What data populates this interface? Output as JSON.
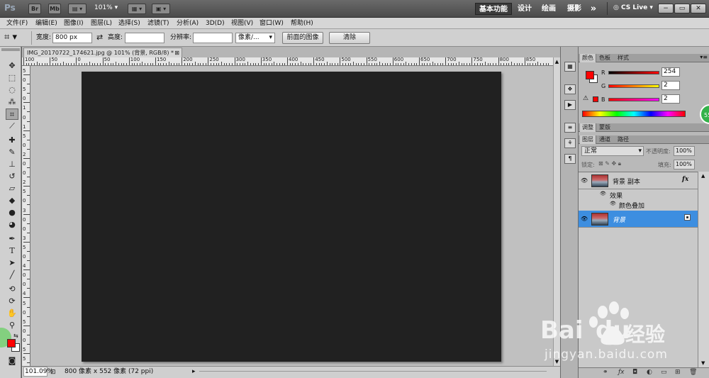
{
  "app": {
    "logo": "Ps",
    "bridge_btn": "Br",
    "minibridge_btn": "Mb",
    "zoom": "101%",
    "workspaces": [
      "基本功能",
      "设计",
      "绘画",
      "摄影"
    ],
    "more": "»",
    "cs_live": "CS Live",
    "window_buttons": [
      "−",
      "▭",
      "✕"
    ]
  },
  "menu": [
    "文件(F)",
    "编辑(E)",
    "图像(I)",
    "图层(L)",
    "选择(S)",
    "滤镜(T)",
    "分析(A)",
    "3D(D)",
    "视图(V)",
    "窗口(W)",
    "帮助(H)"
  ],
  "options": {
    "width_label": "宽度:",
    "width_value": "800 px",
    "height_label": "高度:",
    "height_value": "",
    "resolution_label": "分辨率:",
    "resolution_value": "",
    "unit_value": "像素/...",
    "front_image_btn": "前面的图像",
    "clear_btn": "清除"
  },
  "document": {
    "tab_title": "IMG_20170722_174621.jpg @ 101% (背景, RGB/8) *",
    "ruler_ticks": [
      "100",
      "50",
      "0",
      "50",
      "100",
      "150",
      "200",
      "250",
      "300",
      "350",
      "400",
      "450",
      "500",
      "550",
      "600",
      "650",
      "700",
      "750",
      "800",
      "850"
    ],
    "vruler_ticks": [
      "5",
      "0",
      "5",
      "0",
      "1",
      "0",
      "1",
      "5",
      "0",
      "2",
      "0",
      "0",
      "2",
      "5",
      "0",
      "3",
      "0",
      "0",
      "3",
      "5",
      "0",
      "4",
      "0",
      "0",
      "4",
      "5",
      "0",
      "5",
      "0",
      "0",
      "5",
      "5"
    ]
  },
  "status": {
    "zoom": "101.09%",
    "info": "800 像素 x 552 像素 (72 ppi)"
  },
  "color_panel": {
    "tabs": [
      "颜色",
      "色板",
      "样式"
    ],
    "r_label": "R",
    "g_label": "G",
    "b_label": "B",
    "r_value": "254",
    "g_value": "2",
    "b_value": "2",
    "fg_color": "#fe0202",
    "warning_icon": "⚠"
  },
  "adjust_panel": {
    "tabs": [
      "调整",
      "蒙版"
    ]
  },
  "layers_panel": {
    "tabs": [
      "图层",
      "通道",
      "路径"
    ],
    "blend_mode": "正常",
    "opacity_label": "不透明度:",
    "opacity_value": "100%",
    "lock_label": "锁定:",
    "fill_label": "填充:",
    "fill_value": "100%",
    "layers": [
      {
        "name": "背景 副本",
        "fx": "fx",
        "selected": false
      },
      {
        "name": "背景",
        "selected": true
      }
    ],
    "effects_label": "效果",
    "effect_item": "颜色叠加"
  },
  "overlay": {
    "badge": "55",
    "watermark_text": "Bai",
    "watermark_text2": "du",
    "watermark_cn": "经验",
    "watermark_url": "jingyan.baidu.com"
  }
}
